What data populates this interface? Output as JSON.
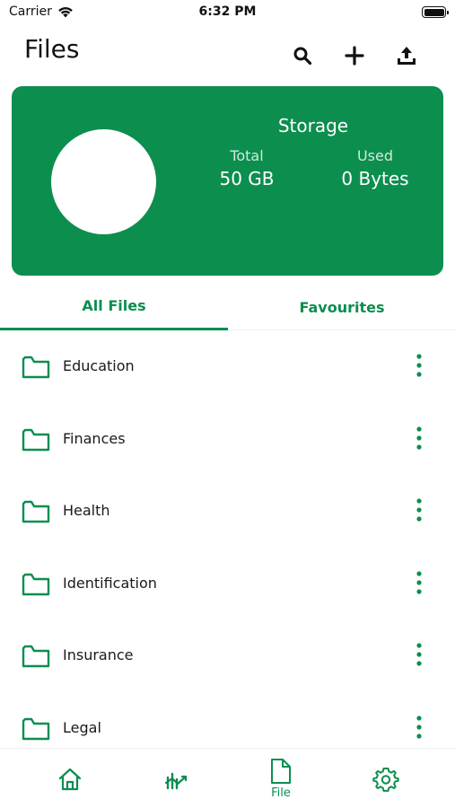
{
  "status_bar": {
    "carrier": "Carrier",
    "time": "6:32 PM"
  },
  "header": {
    "title": "Files",
    "actions": [
      "search-icon",
      "plus-icon",
      "upload-icon"
    ]
  },
  "storage": {
    "title": "Storage",
    "total_label": "Total",
    "total_value": "50 GB",
    "used_label": "Used",
    "used_value": "0 Bytes"
  },
  "tabs": [
    {
      "label": "All Files",
      "active": true
    },
    {
      "label": "Favourites",
      "active": false
    }
  ],
  "folders": [
    {
      "name": "Education"
    },
    {
      "name": "Finances"
    },
    {
      "name": "Health"
    },
    {
      "name": "Identification"
    },
    {
      "name": "Insurance"
    },
    {
      "name": "Legal"
    }
  ],
  "bottom_nav": {
    "items": [
      {
        "icon": "home-icon",
        "label": ""
      },
      {
        "icon": "stats-icon",
        "label": ""
      },
      {
        "icon": "file-icon",
        "label": "File"
      },
      {
        "icon": "gear-icon",
        "label": ""
      }
    ]
  },
  "colors": {
    "accent": "#0c8e4f",
    "card_bg": "#0c8e4f",
    "text": "#1a1a1a"
  }
}
